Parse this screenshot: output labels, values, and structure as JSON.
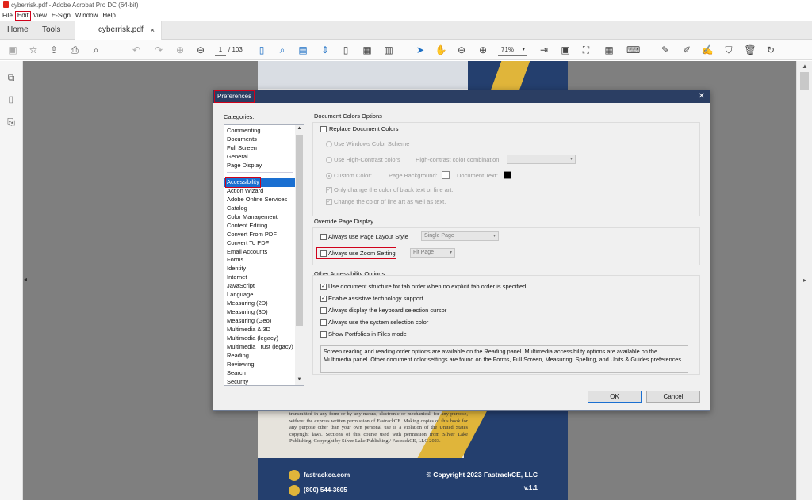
{
  "window": {
    "title": "cyberrisk.pdf - Adobe Acrobat Pro DC (64-bit)"
  },
  "menubar": {
    "items": [
      "File",
      "Edit",
      "View",
      "E-Sign",
      "Window",
      "Help"
    ]
  },
  "tabs": {
    "home": "Home",
    "tools": "Tools",
    "document": "cyberrisk.pdf",
    "close": "×"
  },
  "toolbar": {
    "page_current": "1",
    "page_total": "/ 103",
    "zoom": "71%"
  },
  "page": {
    "legal_text": "transmitted in any form or by any means, electronic or mechanical, for any purpose, without the express written permission of FastrackCE. Making copies of this book for any purpose other than your own personal use is a violation of the United States copyright laws. Sections of this course used with permission from Silver Lake Publishing. Copyright by Silver Lake Publishing / FastrackCE, LLC 2023.",
    "website": "fastrackce.com",
    "phone": "(800) 544-3605",
    "copyright": "© Copyright 2023 FastrackCE, LLC",
    "version": "v.1.1"
  },
  "dialog": {
    "title": "Preferences",
    "categories_label": "Categories:",
    "categories_top": [
      "Commenting",
      "Documents",
      "Full Screen",
      "General",
      "Page Display"
    ],
    "categories": [
      "Accessibility",
      "Action Wizard",
      "Adobe Online Services",
      "Catalog",
      "Color Management",
      "Content Editing",
      "Convert From PDF",
      "Convert To PDF",
      "Email Accounts",
      "Forms",
      "Identity",
      "Internet",
      "JavaScript",
      "Language",
      "Measuring (2D)",
      "Measuring (3D)",
      "Measuring (Geo)",
      "Multimedia & 3D",
      "Multimedia (legacy)",
      "Multimedia Trust (legacy)",
      "Reading",
      "Reviewing",
      "Search",
      "Security"
    ],
    "selected_category": "Accessibility",
    "doc_colors": {
      "heading": "Document Colors Options",
      "replace": "Replace Document Colors",
      "windows_scheme": "Use Windows Color Scheme",
      "high_contrast": "Use High-Contrast colors",
      "high_contrast_combo_label": "High-contrast color combination:",
      "custom_color": "Custom Color:",
      "page_background": "Page Background:",
      "document_text": "Document Text:",
      "only_black_text": "Only change the color of black text or line art.",
      "line_art": "Change the color of line art as well as text."
    },
    "override": {
      "heading": "Override Page Display",
      "page_layout": "Always use Page Layout Style",
      "page_layout_value": "Single Page",
      "zoom_setting": "Always use Zoom Setting",
      "zoom_value": "Fit Page"
    },
    "other": {
      "heading": "Other Accessibility Options",
      "doc_structure": "Use document structure for tab order when no explicit tab order is specified",
      "assistive": "Enable assistive technology support",
      "keyboard_cursor": "Always display the keyboard selection cursor",
      "system_cursor": "Always use the system selection color",
      "portfolios": "Show Portfolios in Files mode",
      "note": "Screen reading and reading order options are available on the Reading panel. Multimedia accessibility options are available on the Multimedia panel. Other document color settings are found on the Forms, Full Screen, Measuring, Spelling, and Units & Guides preferences."
    },
    "ok": "OK",
    "cancel": "Cancel"
  },
  "colors": {
    "accent": "#1a6fd1",
    "highlight": "#d0021b",
    "dialog_title": "#2b3e63",
    "brand_blue": "#243f6e",
    "brand_gold": "#e0b53a"
  }
}
